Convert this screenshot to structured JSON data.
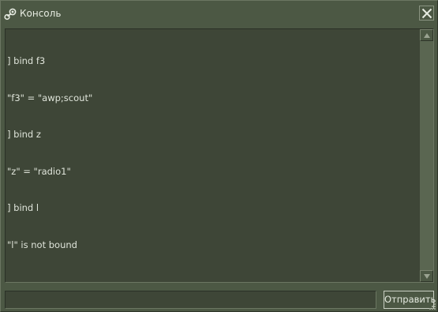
{
  "window": {
    "title": "Консоль",
    "close_icon": "close-icon",
    "title_icon": "steam-icon"
  },
  "console": {
    "lines": [
      "] bind f3",
      "\"f3\" = \"awp;scout\"",
      "] bind z",
      "\"z\" = \"radio1\"",
      "] bind l",
      "\"l\" is not bound"
    ],
    "scroll_position": 0
  },
  "input": {
    "value": "",
    "placeholder": ""
  },
  "submit": {
    "label": "Отправить"
  },
  "colors": {
    "window_bg": "#4c5844",
    "console_bg": "#3e4637",
    "text": "#dfe4da"
  }
}
